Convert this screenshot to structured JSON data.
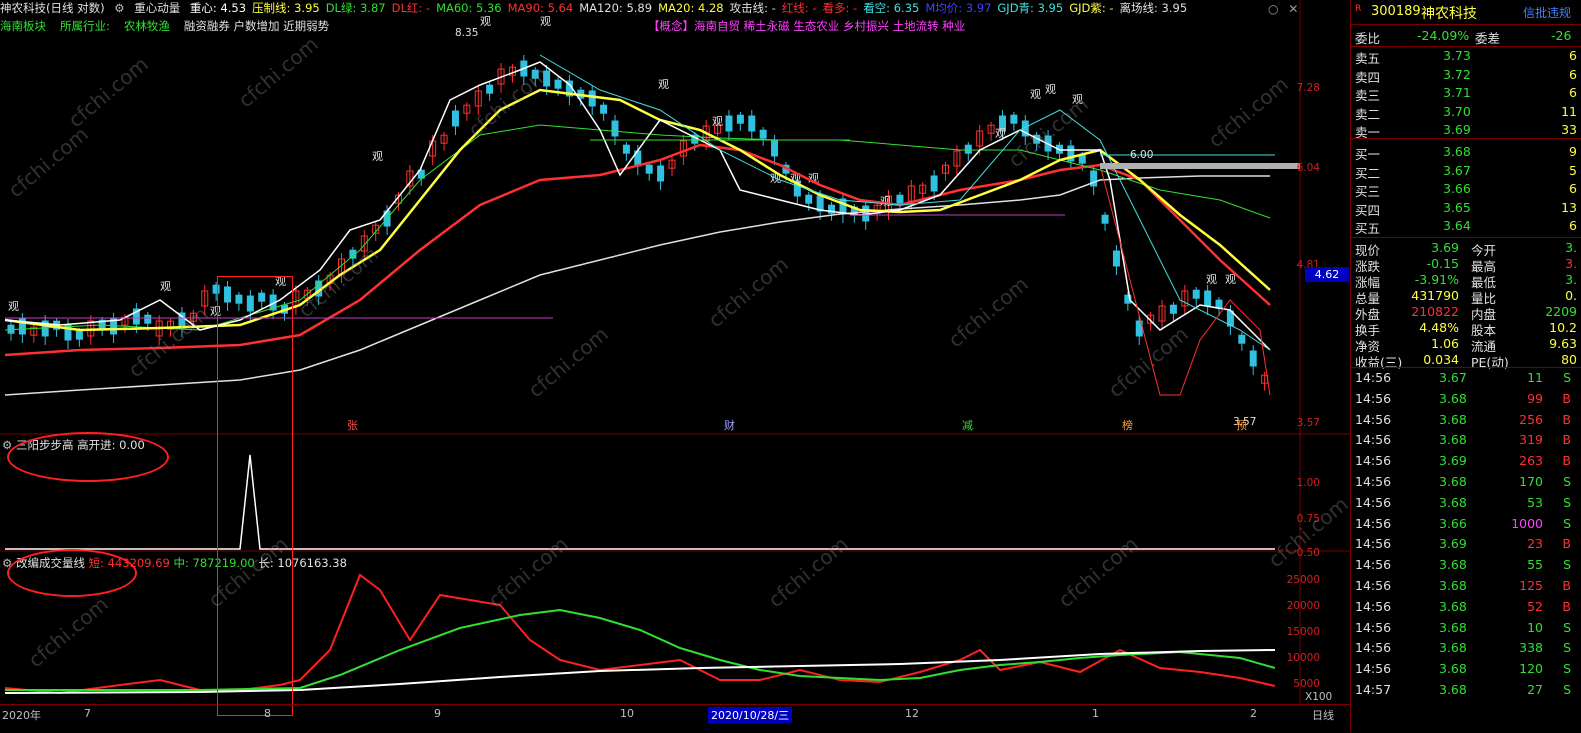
{
  "header": {
    "stock_title": "神农科技(日线 对数)",
    "indicator": "重心动量",
    "items": [
      {
        "label": "重心: 4.53",
        "color": "#ffffff"
      },
      {
        "label": "压制线: 3.95",
        "color": "#ffff40"
      },
      {
        "label": "DL绿: 3.87",
        "color": "#30e030"
      },
      {
        "label": "DL红: -",
        "color": "#ff3030"
      },
      {
        "label": "MA60: 5.36",
        "color": "#30e030"
      },
      {
        "label": "MA90: 5.64",
        "color": "#ff3030"
      },
      {
        "label": "MA120: 5.89",
        "color": "#e0e0e0"
      },
      {
        "label": "MA20: 4.28",
        "color": "#ffff40"
      },
      {
        "label": "攻击线: -",
        "color": "#e0e0e0"
      },
      {
        "label": "红线: -",
        "color": "#ff3030"
      },
      {
        "label": "看多: -",
        "color": "#ff3030"
      },
      {
        "label": "看空: 6.35",
        "color": "#40e0e0"
      },
      {
        "label": "M均价: 3.97",
        "color": "#4040ff"
      },
      {
        "label": "GJD青: 3.95",
        "color": "#40e0e0"
      },
      {
        "label": "GJD紫: -",
        "color": "#ffff40"
      },
      {
        "label": "离场线: 3.95",
        "color": "#e0e0e0"
      }
    ],
    "sub_items": [
      {
        "label": "海南板块",
        "color": "#30e030"
      },
      {
        "label": "所属行业:",
        "color": "#30e030"
      },
      {
        "label": "农林牧渔",
        "color": "#30e030"
      },
      {
        "label": "融资融券 户数增加 近期弱势",
        "color": "#e0e0e0"
      }
    ],
    "concept": "【概念】海南自贸 稀土永磁 生态农业 乡村振兴 土地流转 种业"
  },
  "main_chart": {
    "y_labels": [
      "7.28",
      "6.04",
      "4.81",
      "3.57"
    ],
    "current_price_tag": "4.62",
    "peak_label": "8.35",
    "low_label": "3.57",
    "ref_label": "6.00",
    "markers": [
      "张",
      "财",
      "减",
      "榜",
      "预"
    ],
    "guan": "观"
  },
  "panel2": {
    "title": "三阳步步高",
    "value_label": "高开进: 0.00",
    "y_labels": [
      "1.00",
      "0.75",
      "0.50"
    ]
  },
  "panel3": {
    "title": "改编成交量线",
    "short_label": "短: 443209.69",
    "mid_label": "中: 787219.00",
    "long_label": "长: 1076163.38",
    "y_labels": [
      "25000",
      "20000",
      "15000",
      "10000",
      "5000"
    ],
    "unit": "X100"
  },
  "x_axis": {
    "labels": [
      "2020年",
      "7",
      "8",
      "9",
      "10",
      "2020/10/28/三",
      "12",
      "1",
      "2"
    ],
    "period": "日线"
  },
  "watermark": "cfchi.com",
  "quote": {
    "code": "300189",
    "name": "神农科技",
    "badge": "信批违规",
    "r_mark": "R",
    "weibi_label": "委比",
    "weibi_value": "-24.09%",
    "weicha_label": "委差",
    "weicha_value": "-26",
    "asks": [
      {
        "label": "卖五",
        "price": "3.73",
        "vol": "6"
      },
      {
        "label": "卖四",
        "price": "3.72",
        "vol": "6"
      },
      {
        "label": "卖三",
        "price": "3.71",
        "vol": "6"
      },
      {
        "label": "卖二",
        "price": "3.70",
        "vol": "11"
      },
      {
        "label": "卖一",
        "price": "3.69",
        "vol": "33"
      }
    ],
    "bids": [
      {
        "label": "买一",
        "price": "3.68",
        "vol": "9"
      },
      {
        "label": "买二",
        "price": "3.67",
        "vol": "5"
      },
      {
        "label": "买三",
        "price": "3.66",
        "vol": "6"
      },
      {
        "label": "买四",
        "price": "3.65",
        "vol": "13"
      },
      {
        "label": "买五",
        "price": "3.64",
        "vol": "6"
      }
    ],
    "stats": [
      {
        "l1": "现价",
        "v1": "3.69",
        "c1": "#30e030",
        "l2": "今开",
        "v2": "3.",
        "c2": "#30e030"
      },
      {
        "l1": "涨跌",
        "v1": "-0.15",
        "c1": "#30e030",
        "l2": "最高",
        "v2": "3.",
        "c2": "#ff3030"
      },
      {
        "l1": "涨幅",
        "v1": "-3.91%",
        "c1": "#30e030",
        "l2": "最低",
        "v2": "3.",
        "c2": "#30e030"
      },
      {
        "l1": "总量",
        "v1": "431790",
        "c1": "#ffff40",
        "l2": "量比",
        "v2": "0.",
        "c2": "#ffff40"
      },
      {
        "l1": "外盘",
        "v1": "210822",
        "c1": "#ff3030",
        "l2": "内盘",
        "v2": "2209",
        "c2": "#30e030"
      },
      {
        "l1": "换手",
        "v1": "4.48%",
        "c1": "#ffff40",
        "l2": "股本",
        "v2": "10.2",
        "c2": "#ffff40"
      },
      {
        "l1": "净资",
        "v1": "1.06",
        "c1": "#ffff40",
        "l2": "流通",
        "v2": "9.63",
        "c2": "#ffff40"
      },
      {
        "l1": "收益(三)",
        "v1": "0.034",
        "c1": "#ffff40",
        "l2": "PE(动)",
        "v2": "80",
        "c2": "#ffff40"
      }
    ],
    "ticks": [
      {
        "t": "14:56",
        "p": "3.67",
        "v": "11",
        "s": "S",
        "pc": "#30e030",
        "vc": "#30e030"
      },
      {
        "t": "14:56",
        "p": "3.68",
        "v": "99",
        "s": "B",
        "pc": "#30e030",
        "vc": "#ff3030"
      },
      {
        "t": "14:56",
        "p": "3.68",
        "v": "256",
        "s": "B",
        "pc": "#30e030",
        "vc": "#ff3030"
      },
      {
        "t": "14:56",
        "p": "3.68",
        "v": "319",
        "s": "B",
        "pc": "#30e030",
        "vc": "#ff3030"
      },
      {
        "t": "14:56",
        "p": "3.69",
        "v": "263",
        "s": "B",
        "pc": "#30e030",
        "vc": "#ff3030"
      },
      {
        "t": "14:56",
        "p": "3.68",
        "v": "170",
        "s": "S",
        "pc": "#30e030",
        "vc": "#30e030"
      },
      {
        "t": "14:56",
        "p": "3.68",
        "v": "53",
        "s": "S",
        "pc": "#30e030",
        "vc": "#30e030"
      },
      {
        "t": "14:56",
        "p": "3.66",
        "v": "1000",
        "s": "S",
        "pc": "#30e030",
        "vc": "#ff40ff"
      },
      {
        "t": "14:56",
        "p": "3.69",
        "v": "23",
        "s": "B",
        "pc": "#30e030",
        "vc": "#ff3030"
      },
      {
        "t": "14:56",
        "p": "3.68",
        "v": "55",
        "s": "S",
        "pc": "#30e030",
        "vc": "#30e030"
      },
      {
        "t": "14:56",
        "p": "3.68",
        "v": "125",
        "s": "B",
        "pc": "#30e030",
        "vc": "#ff3030"
      },
      {
        "t": "14:56",
        "p": "3.68",
        "v": "52",
        "s": "B",
        "pc": "#30e030",
        "vc": "#ff3030"
      },
      {
        "t": "14:56",
        "p": "3.68",
        "v": "10",
        "s": "S",
        "pc": "#30e030",
        "vc": "#30e030"
      },
      {
        "t": "14:56",
        "p": "3.68",
        "v": "338",
        "s": "S",
        "pc": "#30e030",
        "vc": "#30e030"
      },
      {
        "t": "14:56",
        "p": "3.68",
        "v": "120",
        "s": "S",
        "pc": "#30e030",
        "vc": "#30e030"
      },
      {
        "t": "14:57",
        "p": "3.68",
        "v": "27",
        "s": "S",
        "pc": "#30e030",
        "vc": "#30e030"
      }
    ]
  }
}
